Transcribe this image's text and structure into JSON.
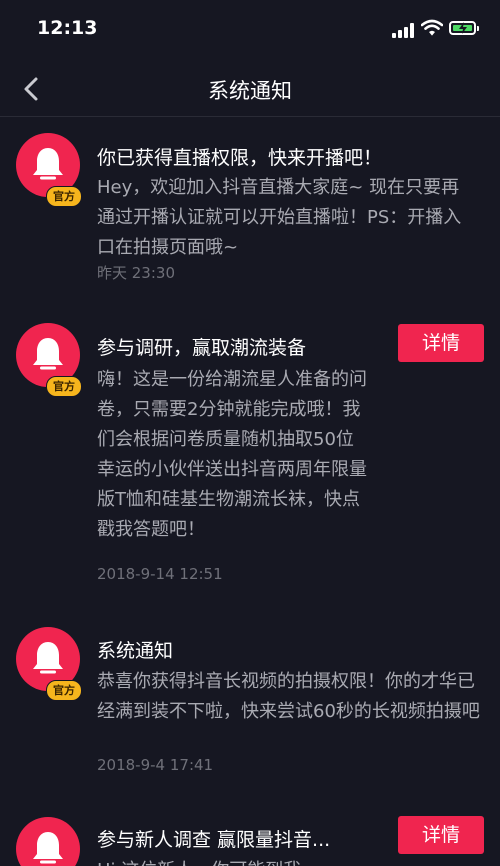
{
  "status_bar": {
    "time": "12:13"
  },
  "header": {
    "title": "系统通知"
  },
  "badge_label": "官方",
  "messages": [
    {
      "title": "你已获得直播权限，快来开播吧！",
      "body": "Hey，欢迎加入抖音直播大家庭~  现在只要再通过开播认证就可以开始直播啦！PS：开播入口在拍摄页面哦~",
      "time": "昨天 23:30"
    },
    {
      "title": "参与调研，赢取潮流装备",
      "button": "详情",
      "body": "嗨！这是一份给潮流星人准备的问卷，只需要2分钟就能完成哦！我们会根据问卷质量随机抽取50位幸运的小伙伴送出抖音两周年限量版T恤和硅基生物潮流长袜，快点戳我答题吧！",
      "time": "2018-9-14 12:51"
    },
    {
      "title": "系统通知",
      "body": "恭喜你获得抖音长视频的拍摄权限！你的才华已经满到装不下啦，快来尝试60秒的长视频拍摄吧",
      "time": "2018-9-4 17:41"
    },
    {
      "title": "参与新人调查 赢限量抖音...",
      "button": "详情",
      "body": "Hi 这位新人，你可能到我"
    }
  ],
  "colors": {
    "accent": "#f0254f",
    "badge": "#f6b51d",
    "background": "#161722"
  }
}
